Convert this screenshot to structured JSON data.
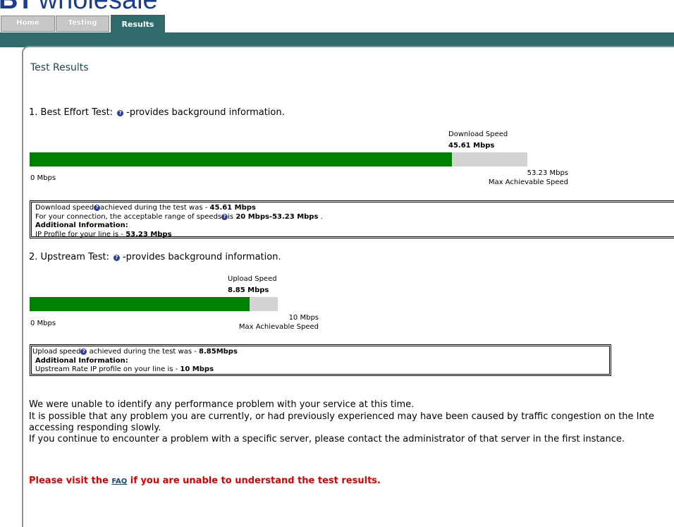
{
  "brand": {
    "bt": "BT",
    "wholesale": "wholesale"
  },
  "tabs": [
    {
      "label": "Home",
      "active": false
    },
    {
      "label": "Testing",
      "active": false
    },
    {
      "label": "Results",
      "active": true
    }
  ],
  "colors": {
    "accent": "#2f6b6b",
    "brand": "#1c3d8f",
    "fill": "#008000",
    "track": "#d3d3d3",
    "alert": "#dd0000"
  },
  "page_title": "Test Results",
  "download": {
    "heading": "1. Best Effort Test:",
    "heading_suffix": "-provides background information.",
    "help_icon": "question-mark-icon",
    "speed_label": "Download Speed",
    "speed_value": "45.61 Mbps",
    "min_label": "0 Mbps",
    "max_value": "53.23 Mbps",
    "max_label": "Max Achievable Speed",
    "fill_fraction": 0.848,
    "box": {
      "line1_pre": "Download speed",
      "line1_mid": "achieved during the test was - ",
      "line1_val": "45.61 Mbps",
      "line2_pre": "For your connection, the acceptable range of speeds",
      "line2_mid": "is ",
      "line2_val": "20 Mbps-53.23 Mbps",
      "line2_post": " .",
      "line3": "Additional Information:",
      "line4_pre": "IP Profile for your line is - ",
      "line4_val": "53.23 Mbps"
    }
  },
  "upload": {
    "heading": "2. Upstream Test:",
    "heading_suffix": "-provides background information.",
    "help_icon": "question-mark-icon",
    "speed_label": "Upload Speed",
    "speed_value": "8.85 Mbps",
    "min_label": "0 Mbps",
    "max_value": "10 Mbps",
    "max_label": "Max Achievable Speed",
    "fill_fraction": 0.885,
    "box": {
      "line1_pre": "Upload speed",
      "line1_mid": " achieved during the test was - ",
      "line1_val": "8.85Mbps",
      "line2": "Additional Information:",
      "line3_pre": "Upstream Rate IP profile on your line is - ",
      "line3_val": "10 Mbps"
    }
  },
  "summary": {
    "p1": "We were unable to identify any performance problem with your service at this time.",
    "p2a": "It is possible that any problem you are currently, or had previously experienced may have been caused by traffic congestion on the Inte",
    "p2b": "accessing responding slowly.",
    "p3": "If you continue to encounter a problem with a specific server, please contact the administrator of that server in the first instance."
  },
  "faq": {
    "pre": "Please visit the ",
    "link": "FAQ",
    "post": " if you are unable to understand the test results."
  }
}
